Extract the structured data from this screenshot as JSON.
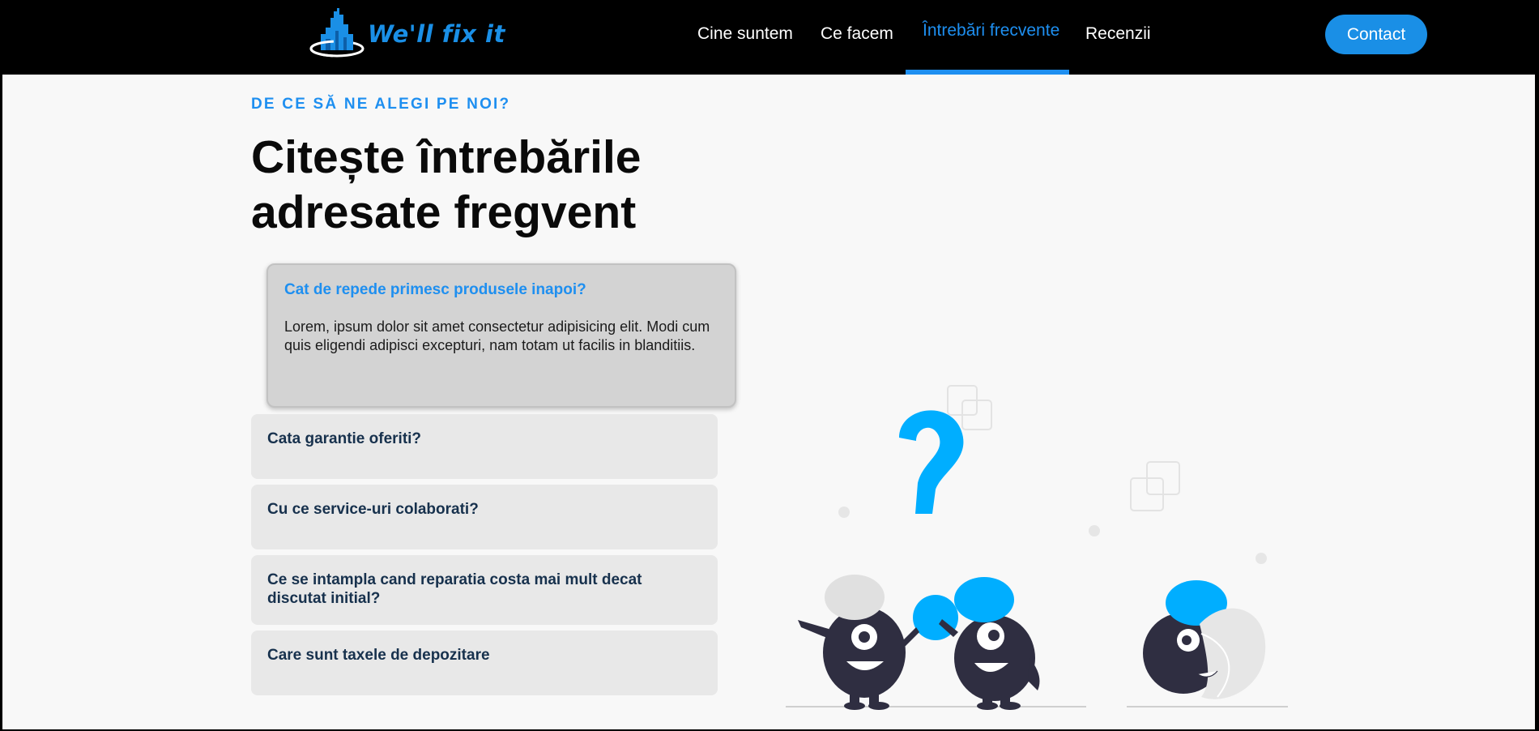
{
  "header": {
    "logo_text": "We'll fix it",
    "nav": [
      {
        "label": "Cine suntem"
      },
      {
        "label": "Ce facem"
      },
      {
        "label": "Întrebări frecvente",
        "active": true
      },
      {
        "label": "Recenzii"
      }
    ],
    "contact_label": "Contact"
  },
  "hero": {
    "eyebrow": "DE CE SĂ NE ALEGI PE NOI?",
    "title_line1": "Citește întrebările",
    "title_line2": "adresate fregvent"
  },
  "faq": {
    "open": {
      "question": "Cat de repede primesc produsele inapoi?",
      "answer": "Lorem, ipsum dolor sit amet consectetur adipisicing elit. Modi cum quis eligendi adipisci excepturi, nam totam ut facilis in blanditiis."
    },
    "items": [
      {
        "question": "Cata garantie oferiti?"
      },
      {
        "question": "Cu ce service-uri colaborati?"
      },
      {
        "question": "Ce se intampla cand reparatia costa mai mult decat discutat initial?"
      },
      {
        "question": "Care sunt taxele de depozitare"
      }
    ]
  },
  "colors": {
    "accent": "#1e8ff0",
    "header_bg": "#000000",
    "page_bg": "#f8f8f8",
    "faq_open_bg": "#d3d3d3",
    "faq_item_bg": "#e8e8e8",
    "illus_blue": "#00aeff",
    "illus_dark": "#2f2e41"
  },
  "icons": {
    "logo": "city-skyline-logo-icon",
    "illustration": "question-mark-characters-illustration"
  }
}
